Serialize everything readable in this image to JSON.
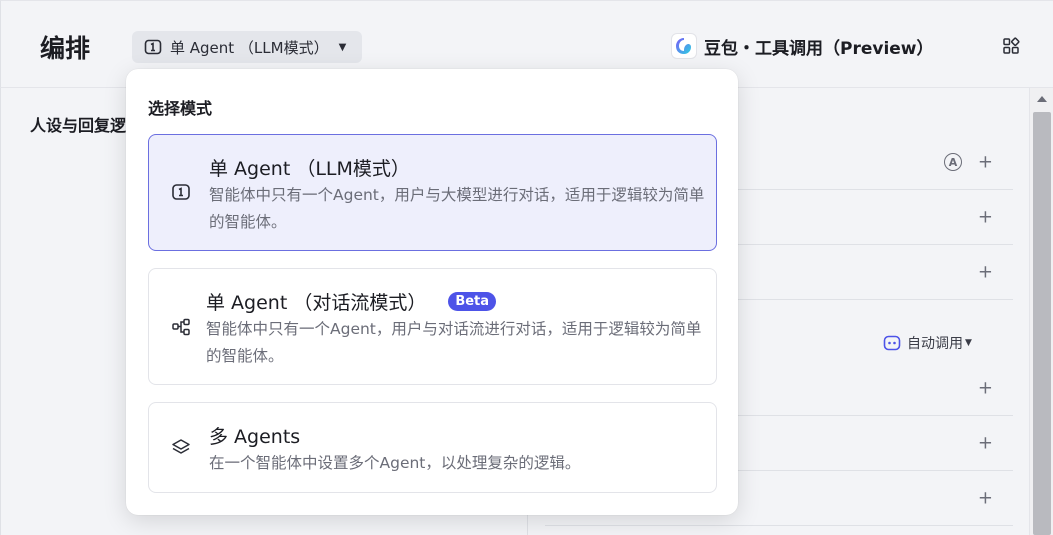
{
  "header": {
    "title": "编排",
    "mode_select_label": "单 Agent （LLM模式）",
    "preview_title": "豆包・工具调用（Preview）"
  },
  "left": {
    "section_label": "人设与回复逻辑"
  },
  "right": {
    "auto_call_label": "自动调用"
  },
  "dropdown": {
    "heading": "选择模式",
    "options": [
      {
        "title": "单 Agent （LLM模式）",
        "desc": "智能体中只有一个Agent，用户与大模型进行对话，适用于逻辑较为简单的智能体。"
      },
      {
        "title": "单 Agent （对话流模式）",
        "badge": "Beta",
        "desc": "智能体中只有一个Agent，用户与对话流进行对话，适用于逻辑较为简单的智能体。"
      },
      {
        "title": "多 Agents",
        "desc": "在一个智能体中设置多个Agent，以处理复杂的逻辑。"
      }
    ]
  },
  "colors": {
    "accent": "#4d53e8",
    "selected_bg": "#eeeffc",
    "selected_border": "#6b6fe0"
  }
}
